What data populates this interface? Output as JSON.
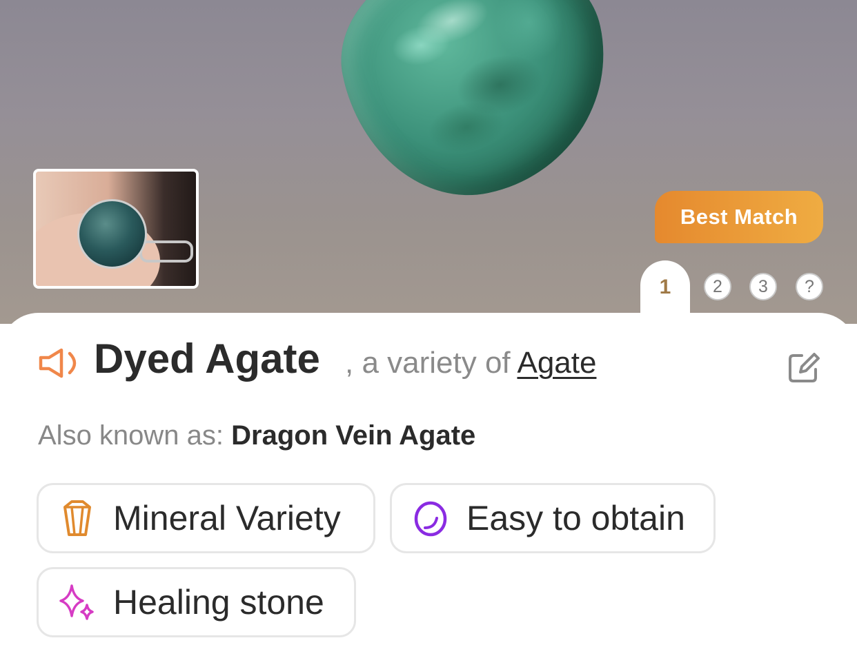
{
  "hero": {
    "badge": "Best Match"
  },
  "tabs": [
    "1",
    "2",
    "3",
    "?"
  ],
  "result": {
    "name": "Dyed Agate",
    "variety_prefix": ", a variety of ",
    "variety_parent": "Agate",
    "aka_label": "Also known as: ",
    "aka_value": "Dragon Vein Agate"
  },
  "chips": [
    {
      "label": "Mineral Variety",
      "icon": "crystal-icon",
      "color": "#e08a2e"
    },
    {
      "label": "Easy to obtain",
      "icon": "stone-ring-icon",
      "color": "#8a2be2"
    },
    {
      "label": "Healing stone",
      "icon": "sparkle-icon",
      "color": "#d63cc4"
    }
  ],
  "colors": {
    "badge_start": "#e5892e",
    "badge_end": "#efac42",
    "speaker": "#f0874a",
    "tab_active_text": "#a07a47"
  }
}
